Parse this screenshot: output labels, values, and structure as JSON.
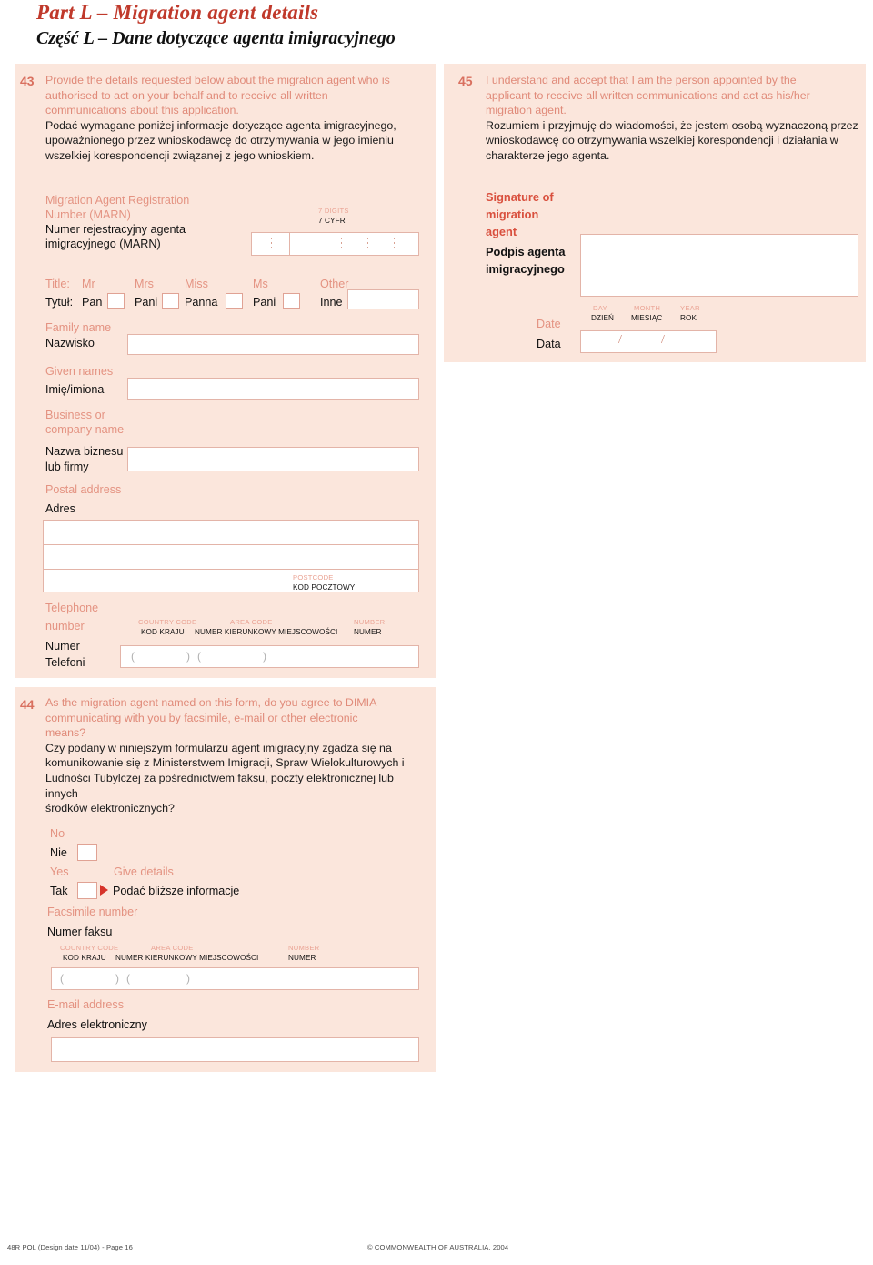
{
  "header": {
    "part_en": "Part L – Migration agent details",
    "part_pl": "Część L – Dane dotyczące agenta imigracyjnego"
  },
  "q43": {
    "number": "43",
    "en_lines": [
      "Provide the details requested below about the migration agent who is",
      "authorised to act on your behalf and to receive all written",
      "communications about this application."
    ],
    "pl_lines": [
      "Podać wymagane poniżej informacje dotyczące agenta imigracyjnego,",
      "upoważnionego przez wnioskodawcę do otrzymywania w jego imieniu",
      "wszelkiej korespondencji związanej z jego wnioskiem."
    ],
    "marn": {
      "label_en_1": "Migration Agent Registration",
      "label_en_2": "Number (MARN)",
      "label_pl_1": "Numer rejestracyjny agenta",
      "label_pl_2": "imigracyjnego (MARN)",
      "digits_en": "7 DIGITS",
      "digits_pl": "7 CYFR"
    },
    "title_row": {
      "label_en": "Title:",
      "label_pl": "Tytuł:",
      "options": [
        {
          "en": "Mr",
          "pl": "Pan"
        },
        {
          "en": "Mrs",
          "pl": "Pani"
        },
        {
          "en": "Miss",
          "pl": "Panna"
        },
        {
          "en": "Ms",
          "pl": "Pani"
        },
        {
          "en": "Other",
          "pl": "Inne"
        }
      ]
    },
    "family_name": {
      "en": "Family name",
      "pl": "Nazwisko"
    },
    "given_names": {
      "en": "Given names",
      "pl": "Imię/imiona"
    },
    "business": {
      "en_1": "Business or",
      "en_2": "company name",
      "pl_1": "Nazwa biznesu",
      "pl_2": "lub firmy"
    },
    "postal_address": {
      "en": "Postal address",
      "pl": "Adres"
    },
    "postcode": {
      "en": "POSTCODE",
      "pl": "KOD POCZTOWY"
    },
    "telephone": {
      "en_1": "Telephone",
      "en_2": "number",
      "pl_1": "Numer",
      "pl_2": "Telefoni",
      "country_en": "COUNTRY CODE",
      "country_pl": "KOD KRAJU",
      "area_en": "AREA CODE",
      "area_pl": "NUMER KIERUNKOWY MIEJSCOWOŚCI",
      "number_en": "NUMBER",
      "number_pl": "NUMER"
    }
  },
  "q44": {
    "number": "44",
    "en_lines": [
      "As the migration agent named on this form, do you agree to DIMIA",
      "communicating with you by facsimile, e-mail or other electronic",
      "means?"
    ],
    "pl_lines": [
      "Czy podany w niniejszym formularzu agent imigracyjny zgadza się na",
      "komunikowanie się z Ministerstwem Imigracji, Spraw Wielokulturowych i",
      "Ludności Tubylczej za pośrednictwem faksu, poczty elektronicznej lub innych",
      "środków elektronicznych?"
    ],
    "no": {
      "en": "No",
      "pl": "Nie"
    },
    "yes": {
      "en": "Yes",
      "pl": "Tak"
    },
    "give_details": {
      "en": "Give details",
      "pl": "Podać bliższe informacje"
    },
    "facsimile": {
      "en": "Facsimile number",
      "pl": "Numer faksu",
      "country_en": "COUNTRY CODE",
      "country_pl": "KOD KRAJU",
      "area_en": "AREA CODE",
      "area_pl": "NUMER KIERUNKOWY MIEJSCOWOŚCI",
      "number_en": "NUMBER",
      "number_pl": "NUMER"
    },
    "email": {
      "en": "E-mail address",
      "pl": "Adres elektroniczny"
    }
  },
  "q45": {
    "number": "45",
    "en_lines": [
      "I understand and accept that I am the person appointed by the",
      "applicant to receive all written communications and act as his/her",
      "migration agent."
    ],
    "pl_lines": [
      "Rozumiem i przyjmuję do wiadomości, że jestem osobą wyznaczoną przez",
      "wnioskodawcę do otrzymywania wszelkiej korespondencji i działania w",
      "charakterze jego agenta."
    ],
    "signature": {
      "en_1": "Signature of",
      "en_2": "migration",
      "en_3": "agent",
      "pl_1": "Podpis agenta",
      "pl_2": "imigracyjnego"
    },
    "date": {
      "en": "Date",
      "pl": "Data",
      "day_en": "DAY",
      "day_pl": "DZIEŃ",
      "month_en": "MONTH",
      "month_pl": "MIESIĄC",
      "year_en": "YEAR",
      "year_pl": "ROK",
      "sep": "/"
    }
  },
  "footer": {
    "left": "48R POL (Design date 11/04) - Page 16",
    "right": "© COMMONWEALTH OF AUSTRALIA, 2004"
  },
  "colors": {
    "accent_red": "#c0392b",
    "label_en": "#e49382",
    "panel_bg": "#fbe6dc",
    "field_border": "#e3b4a8"
  }
}
